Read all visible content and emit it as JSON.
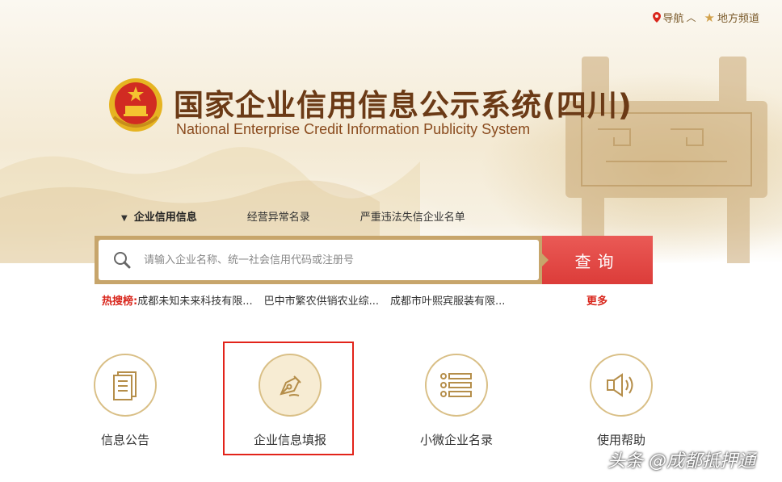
{
  "topnav": {
    "nav_label": "导航",
    "region_label": "地方频道"
  },
  "header": {
    "title_cn": "国家企业信用信息公示系统(四川)",
    "title_en": "National Enterprise Credit Information Publicity System"
  },
  "tabs": [
    {
      "label": "企业信用信息",
      "active": true
    },
    {
      "label": "经营异常名录",
      "active": false
    },
    {
      "label": "严重违法失信企业名单",
      "active": false
    }
  ],
  "search": {
    "placeholder": "请输入企业名称、统一社会信用代码或注册号",
    "value": "",
    "button_label": "查询"
  },
  "hot_search": {
    "label": "热搜榜:",
    "items": [
      "成都未知未来科技有限...",
      "巴中市繁农供销农业综...",
      "成都市叶熙宾服装有限..."
    ],
    "more_label": "更多"
  },
  "services": [
    {
      "label": "信息公告",
      "icon": "document-icon"
    },
    {
      "label": "企业信息填报",
      "icon": "pen-nib-icon",
      "highlighted": true
    },
    {
      "label": "小微企业名录",
      "icon": "list-icon"
    },
    {
      "label": "使用帮助",
      "icon": "speaker-icon"
    }
  ],
  "watermark": "头条 @成都抵押通",
  "colors": {
    "accent_red": "#dc3c39",
    "gold": "#c7a56b",
    "title_brown": "#6b3a16"
  }
}
